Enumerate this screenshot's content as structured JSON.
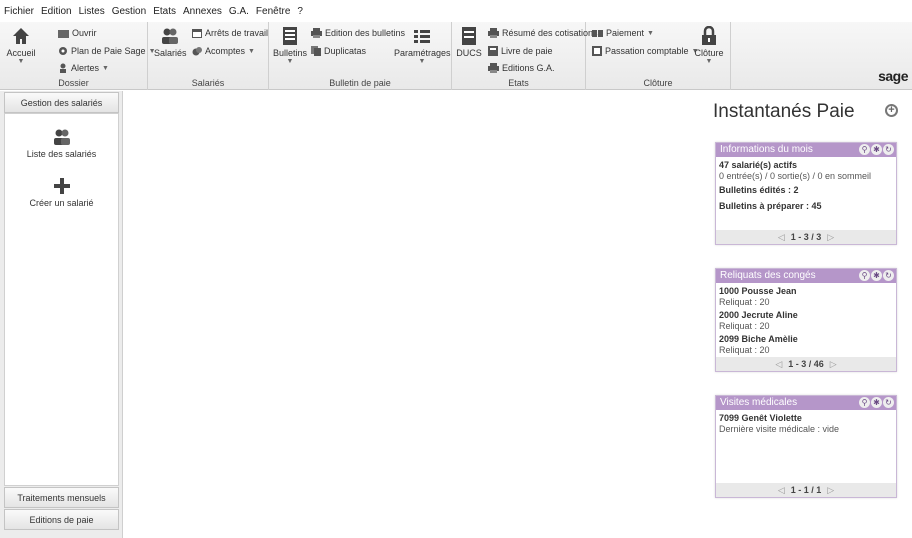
{
  "menu": [
    "Fichier",
    "Edition",
    "Listes",
    "Gestion",
    "Etats",
    "Annexes",
    "G.A.",
    "Fenêtre",
    "?"
  ],
  "ribbon": {
    "dossier": {
      "accueil": "Accueil",
      "ouvrir": "Ouvrir",
      "plan": "Plan de Paie Sage",
      "alertes": "Alertes",
      "label": "Dossier"
    },
    "salaries": {
      "salaries": "Salariés",
      "arrets": "Arrêts de travail",
      "acomptes": "Acomptes",
      "label": "Salariés"
    },
    "bulletin": {
      "bulletins": "Bulletins",
      "edition": "Edition des bulletins",
      "duplicatas": "Duplicatas",
      "parametrages": "Paramétrages",
      "label": "Bulletin de paie"
    },
    "etats": {
      "ducs": "DUCS",
      "resume": "Résumé des cotisations",
      "livre": "Livre de paie",
      "editions_ga": "Editions G.A.",
      "label": "Etats"
    },
    "cloture": {
      "paiement": "Paiement",
      "passation": "Passation comptable",
      "cloture": "Clôture",
      "label": "Clôture"
    },
    "logo": "sage"
  },
  "sidebar": {
    "tab_top": "Gestion des salariés",
    "items": [
      {
        "label": "Liste des salariés"
      },
      {
        "label": "Créer un salarié"
      }
    ],
    "tab_bottom_1": "Traitements mensuels",
    "tab_bottom_2": "Editions de paie"
  },
  "main": {
    "title": "Instantanés Paie"
  },
  "widgets": {
    "info": {
      "title": "Informations du mois",
      "line1": "47 salarié(s) actifs",
      "line2": "0 entrée(s) / 0 sortie(s) / 0 en sommeil",
      "line3": "Bulletins édités : 2",
      "line4": "Bulletins à préparer : 45",
      "pager": "1 - 3 / 3"
    },
    "conges": {
      "title": "Reliquats des congés",
      "rows": [
        {
          "name": "1000 Pousse Jean",
          "detail": "Reliquat : 20"
        },
        {
          "name": "2000 Jecrute Aline",
          "detail": "Reliquat : 20"
        },
        {
          "name": "2099 Biche Amèlie",
          "detail": "Reliquat : 20"
        }
      ],
      "pager": "1 - 3 / 46"
    },
    "visites": {
      "title": "Visites médicales",
      "name": "7099 Genêt Violette",
      "detail": "Dernière visite médicale : vide",
      "pager": "1 - 1 / 1"
    }
  },
  "colors": {
    "accent": "#b596c9",
    "purple_dark": "#6a2c91",
    "green": "#7fbf3a",
    "deco_light": "#c9e6a8"
  }
}
